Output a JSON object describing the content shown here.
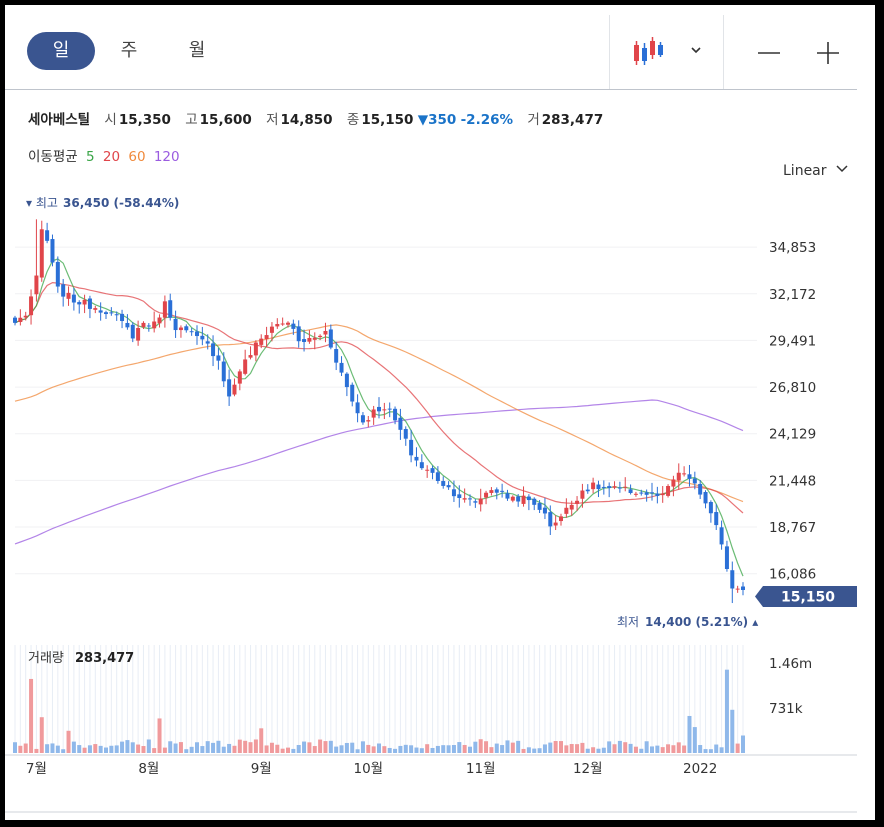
{
  "toolbar": {
    "tabs": [
      {
        "label": "일",
        "active": true
      },
      {
        "label": "주",
        "active": false
      },
      {
        "label": "월",
        "active": false
      }
    ],
    "chart_type_icon": "candlestick-icon",
    "dropdown_icon": "chevron-down-icon",
    "zoom_out_icon": "minus-icon",
    "zoom_in_icon": "plus-icon"
  },
  "info": {
    "name": "세아베스틸",
    "open_label": "시",
    "open": "15,350",
    "high_label": "고",
    "high": "15,600",
    "low_label": "저",
    "low": "14,850",
    "close_label": "종",
    "close": "15,150",
    "change": "▼350",
    "change_pct": "-2.26%",
    "volume_label": "거",
    "volume": "283,477"
  },
  "moving_average": {
    "label": "이동평균",
    "periods": [
      {
        "label": "5",
        "color": "#3aa547"
      },
      {
        "label": "20",
        "color": "#e0454a"
      },
      {
        "label": "60",
        "color": "#f08a3c"
      },
      {
        "label": "120",
        "color": "#9a5ce0"
      }
    ]
  },
  "scale": {
    "label": "Linear"
  },
  "annotations": {
    "max_label": "▾ 최고",
    "max_value": "36,450 (-58.44%)",
    "min_label": "최저",
    "min_value": "14,400 (5.21%) ▴",
    "current_price": "15,150"
  },
  "volume_panel": {
    "label": "거래량",
    "value": "283,477"
  },
  "colors": {
    "up": "#e0454a",
    "down": "#2a6fd6",
    "ma5": "#3aa547",
    "ma20": "#e0454a",
    "ma60": "#f08a3c",
    "ma120": "#9a5ce0",
    "price_tag": "#3a5590"
  },
  "chart_data": {
    "type": "candlestick",
    "y_ticks": [
      "34,853",
      "32,172",
      "29,491",
      "26,810",
      "24,129",
      "21,448",
      "18,767",
      "16,086"
    ],
    "y_tick_values": [
      34853,
      32172,
      29491,
      26810,
      24129,
      21448,
      18767,
      16086
    ],
    "volume_ticks": [
      "1.46m",
      "731k"
    ],
    "volume_tick_values": [
      1460000,
      731000
    ],
    "x_ticks": [
      "7월",
      "8월",
      "9월",
      "10월",
      "11월",
      "12월",
      "2022"
    ],
    "x_tick_index": [
      4,
      25,
      46,
      66,
      87,
      107,
      128
    ],
    "anchors": [
      [
        0,
        30500
      ],
      [
        2,
        31000
      ],
      [
        4,
        33000
      ],
      [
        5,
        35800
      ],
      [
        6,
        35200
      ],
      [
        8,
        32400
      ],
      [
        11,
        31800
      ],
      [
        14,
        31500
      ],
      [
        17,
        31200
      ],
      [
        19,
        30800
      ],
      [
        22,
        29800
      ],
      [
        24,
        30500
      ],
      [
        26,
        30400
      ],
      [
        28,
        31600
      ],
      [
        30,
        30300
      ],
      [
        33,
        29800
      ],
      [
        36,
        29200
      ],
      [
        38,
        28400
      ],
      [
        40,
        26200
      ],
      [
        42,
        27800
      ],
      [
        45,
        29200
      ],
      [
        48,
        30300
      ],
      [
        51,
        30600
      ],
      [
        53,
        29400
      ],
      [
        56,
        29600
      ],
      [
        58,
        30000
      ],
      [
        59,
        29200
      ],
      [
        61,
        27600
      ],
      [
        63,
        26000
      ],
      [
        65,
        24800
      ],
      [
        67,
        25400
      ],
      [
        69,
        25700
      ],
      [
        70,
        25400
      ],
      [
        72,
        24300
      ],
      [
        74,
        23000
      ],
      [
        76,
        22200
      ],
      [
        78,
        21800
      ],
      [
        81,
        21000
      ],
      [
        84,
        20300
      ],
      [
        86,
        20200
      ],
      [
        89,
        21000
      ],
      [
        92,
        20500
      ],
      [
        95,
        20400
      ],
      [
        98,
        19900
      ],
      [
        100,
        18900
      ],
      [
        102,
        19400
      ],
      [
        104,
        20100
      ],
      [
        106,
        20900
      ],
      [
        108,
        21100
      ],
      [
        110,
        21000
      ],
      [
        113,
        20900
      ],
      [
        116,
        20800
      ],
      [
        119,
        20600
      ],
      [
        121,
        20500
      ],
      [
        123,
        21500
      ],
      [
        125,
        21900
      ],
      [
        127,
        21100
      ],
      [
        129,
        20200
      ],
      [
        131,
        18700
      ],
      [
        133,
        16500
      ],
      [
        134,
        15350
      ],
      [
        135,
        15300
      ],
      [
        136,
        15150
      ]
    ],
    "highlight_volumes": [
      [
        3,
        1200000
      ],
      [
        5,
        580000
      ],
      [
        10,
        360000
      ],
      [
        27,
        560000
      ],
      [
        46,
        400000
      ],
      [
        126,
        600000
      ],
      [
        127,
        420000
      ],
      [
        133,
        1350000
      ],
      [
        134,
        700000
      ]
    ],
    "max_price": 36450,
    "min_price": 14400,
    "last_close": 15150,
    "last_volume": 283477,
    "ylim": [
      14000,
      37100
    ]
  }
}
